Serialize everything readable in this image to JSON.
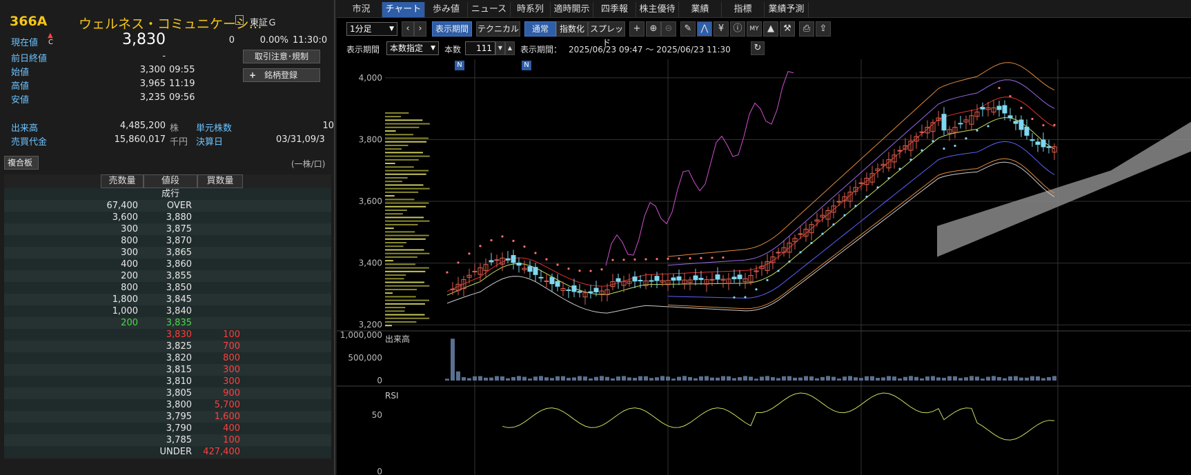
{
  "quote": {
    "code": "366A",
    "name": "ウェルネス・コミュニケーシ…",
    "market": "東証Ｇ",
    "current_label": "現在値",
    "current_marker": "C",
    "current_value": "3,830",
    "change": "0",
    "change_pct": "0.00%",
    "time": "11:30:0",
    "prev_close_label": "前日終値",
    "prev_close_value": "-",
    "open_label": "始値",
    "open_value": "3,300",
    "open_time": "09:55",
    "high_label": "高値",
    "high_value": "3,965",
    "high_time": "11:19",
    "low_label": "安値",
    "low_value": "3,235",
    "low_time": "09:56",
    "volume_label": "出来高",
    "volume_value": "4,485,200",
    "volume_unit": "株",
    "turnover_label": "売買代金",
    "turnover_value": "15,860,017",
    "turnover_unit": "千円",
    "unit_shares_label": "単元株数",
    "unit_shares_value": "10",
    "settlement_label": "決算日",
    "settlement_value": "03/31,09/3"
  },
  "buttons": {
    "trade_caution": "取引注意･規制",
    "register": "銘柄登録",
    "register_plus": "+",
    "composite_board": "複合板",
    "per_share_note": "(一株/口)"
  },
  "order_book": {
    "headers": {
      "sell_qty": "売数量",
      "price": "値段",
      "buy_qty": "買数量"
    },
    "rows": [
      {
        "sell": "",
        "price": "成行",
        "buy": "",
        "type": "market"
      },
      {
        "sell": "67,400",
        "price": "OVER",
        "buy": "",
        "type": "normal"
      },
      {
        "sell": "3,600",
        "price": "3,880",
        "buy": "",
        "type": "normal"
      },
      {
        "sell": "300",
        "price": "3,875",
        "buy": "",
        "type": "normal"
      },
      {
        "sell": "800",
        "price": "3,870",
        "buy": "",
        "type": "normal"
      },
      {
        "sell": "300",
        "price": "3,865",
        "buy": "",
        "type": "normal"
      },
      {
        "sell": "400",
        "price": "3,860",
        "buy": "",
        "type": "normal"
      },
      {
        "sell": "200",
        "price": "3,855",
        "buy": "",
        "type": "normal"
      },
      {
        "sell": "800",
        "price": "3,850",
        "buy": "",
        "type": "normal"
      },
      {
        "sell": "1,800",
        "price": "3,845",
        "buy": "",
        "type": "normal"
      },
      {
        "sell": "1,000",
        "price": "3,840",
        "buy": "",
        "type": "normal"
      },
      {
        "sell": "200",
        "price": "3,835",
        "buy": "",
        "type": "best_ask"
      },
      {
        "sell": "",
        "price": "3,830",
        "buy": "100",
        "type": "best_bid"
      },
      {
        "sell": "",
        "price": "3,825",
        "buy": "700",
        "type": "normal"
      },
      {
        "sell": "",
        "price": "3,820",
        "buy": "800",
        "type": "normal"
      },
      {
        "sell": "",
        "price": "3,815",
        "buy": "300",
        "type": "normal"
      },
      {
        "sell": "",
        "price": "3,810",
        "buy": "300",
        "type": "normal"
      },
      {
        "sell": "",
        "price": "3,805",
        "buy": "900",
        "type": "normal"
      },
      {
        "sell": "",
        "price": "3,800",
        "buy": "5,700",
        "type": "normal"
      },
      {
        "sell": "",
        "price": "3,795",
        "buy": "1,600",
        "type": "normal"
      },
      {
        "sell": "",
        "price": "3,790",
        "buy": "400",
        "type": "normal"
      },
      {
        "sell": "",
        "price": "3,785",
        "buy": "100",
        "type": "normal"
      },
      {
        "sell": "",
        "price": "UNDER",
        "buy": "427,400",
        "type": "normal"
      }
    ]
  },
  "tabs": [
    "市況",
    "チャート",
    "歩み値",
    "ニュース",
    "時系列",
    "適時開示",
    "四季報",
    "株主優待",
    "業績",
    "指標",
    "業績予測"
  ],
  "active_tab": 1,
  "toolbar": {
    "interval": "1分足",
    "display_period": "表示期間",
    "technical": "テクニカル",
    "normal": "通常",
    "index": "指数化",
    "spread": "スプレッド"
  },
  "period_bar": {
    "label": "表示期間",
    "mode": "本数指定",
    "count_label": "本数",
    "count_value": "111",
    "range_label": "表示期間：",
    "range_value": "2025/06/23 09:47 ～ 2025/06/23 11:30"
  },
  "chart_labels": {
    "volume": "出来高",
    "rsi": "RSI",
    "news_marker": "N"
  },
  "colors": {
    "up_candle": "#e06050",
    "down_candle": "#7fd8f0",
    "rsi_line": "#c8e060",
    "ask_green": "#4cd94c",
    "bid_red": "#ff3b3b",
    "accent": "#2f5ea8"
  },
  "chart_data": [
    {
      "type": "candlestick",
      "interval": "1分足",
      "yticks": [
        3200,
        3400,
        3600,
        3800,
        4000
      ],
      "ylim": [
        3100,
        4060
      ],
      "bars": 111
    },
    {
      "type": "bar",
      "title": "出来高",
      "yticks": [
        "1,000,000",
        "500,000",
        "0"
      ],
      "ylim": [
        0,
        1000000
      ]
    },
    {
      "type": "line",
      "title": "RSI",
      "yticks": [
        "50",
        "0"
      ],
      "ylim": [
        0,
        100
      ]
    }
  ]
}
